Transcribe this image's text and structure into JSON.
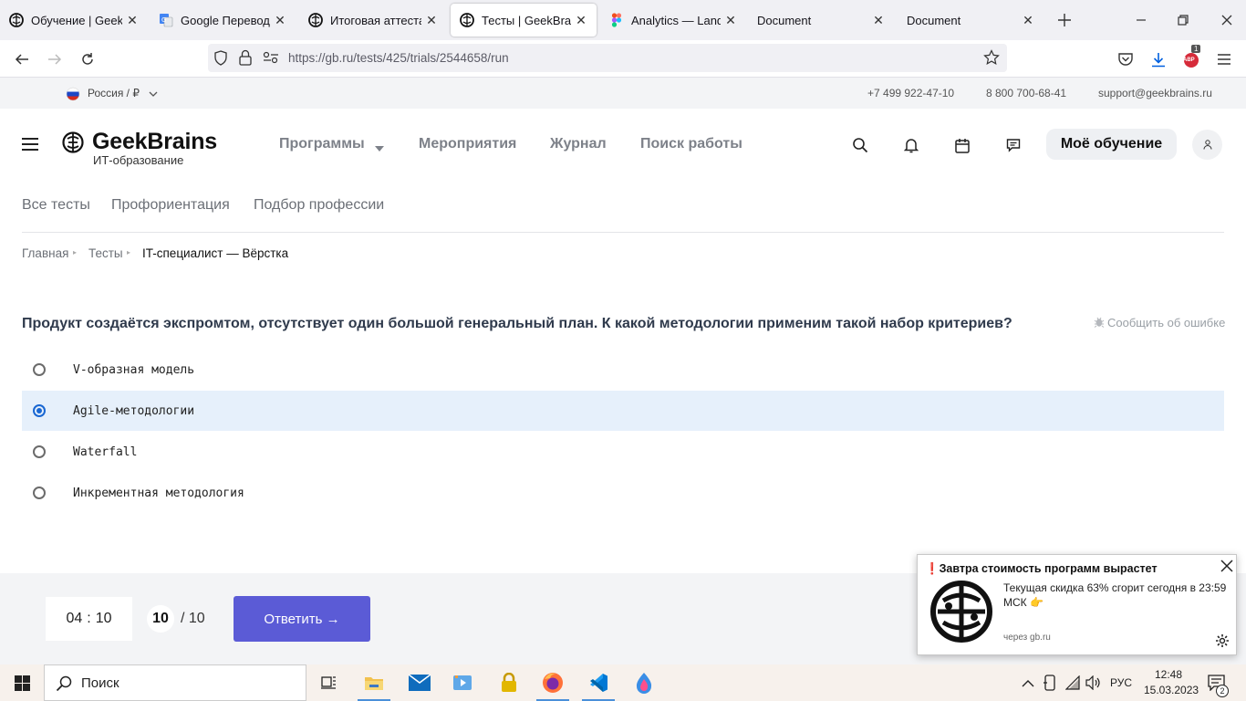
{
  "browser": {
    "tabs": [
      {
        "title": "Обучение | GeekBrains",
        "icon": "geekbrains-icon",
        "active": false
      },
      {
        "title": "Google Переводчик",
        "icon": "google-translate-icon",
        "active": false
      },
      {
        "title": "Итоговая аттестация",
        "icon": "geekbrains-icon",
        "active": false
      },
      {
        "title": "Тесты | GeekBrains - ",
        "icon": "geekbrains-icon",
        "active": true
      },
      {
        "title": "Analytics — Landing",
        "icon": "figma-icon",
        "active": false
      },
      {
        "title": "Document",
        "icon": "none",
        "active": false
      },
      {
        "title": "Document",
        "icon": "none",
        "active": false
      }
    ],
    "url": "https://gb.ru/tests/425/trials/2544658/run",
    "extension_badge": "1",
    "extension_label": "ABP"
  },
  "site": {
    "region": "Россия / ₽",
    "phone1": "+7 499 922-47-10",
    "phone2": "8 800 700-68-41",
    "email": "support@geekbrains.ru",
    "logo_text": "GeekBrains",
    "logo_sub": "ИТ-образование",
    "menu": [
      "Программы",
      "Мероприятия",
      "Журнал",
      "Поиск работы"
    ],
    "my_learning": "Моё обучение",
    "subnav": [
      "Все тесты",
      "Профориентация",
      "Подбор профессии"
    ],
    "breadcrumbs": [
      "Главная",
      "Тесты",
      "IT-специалист — Вёрстка"
    ]
  },
  "test": {
    "question": "Продукт создаётся экспромтом, отсутствует один большой генеральный план. К какой методологии применим такой набор критериев?",
    "report_error": "Сообщить об ошибке",
    "options": [
      {
        "label": "V-образная модель",
        "selected": false
      },
      {
        "label": "Agile-методологии",
        "selected": true
      },
      {
        "label": "Waterfall",
        "selected": false
      },
      {
        "label": "Инкрементная методология",
        "selected": false
      }
    ],
    "timer_min": "04",
    "timer_sep": ":",
    "timer_sec": "10",
    "current": "10",
    "total": "/ 10",
    "answer_button": "Ответить →"
  },
  "notification": {
    "title": "❗Завтра стоимость программ вырастет",
    "body": "Текущая скидка 63% сгорит сегодня в 23:59 МСК 👉",
    "source": "через gb.ru"
  },
  "taskbar": {
    "search_placeholder": "Поиск",
    "lang": "РУС",
    "time": "12:48",
    "date": "15.03.2023",
    "notif_count": "2"
  },
  "colors": {
    "accent": "#5b5bd6",
    "selected_bg": "#e6f0fb",
    "radio_on": "#1967d2",
    "heading": "#2f3a4c"
  }
}
